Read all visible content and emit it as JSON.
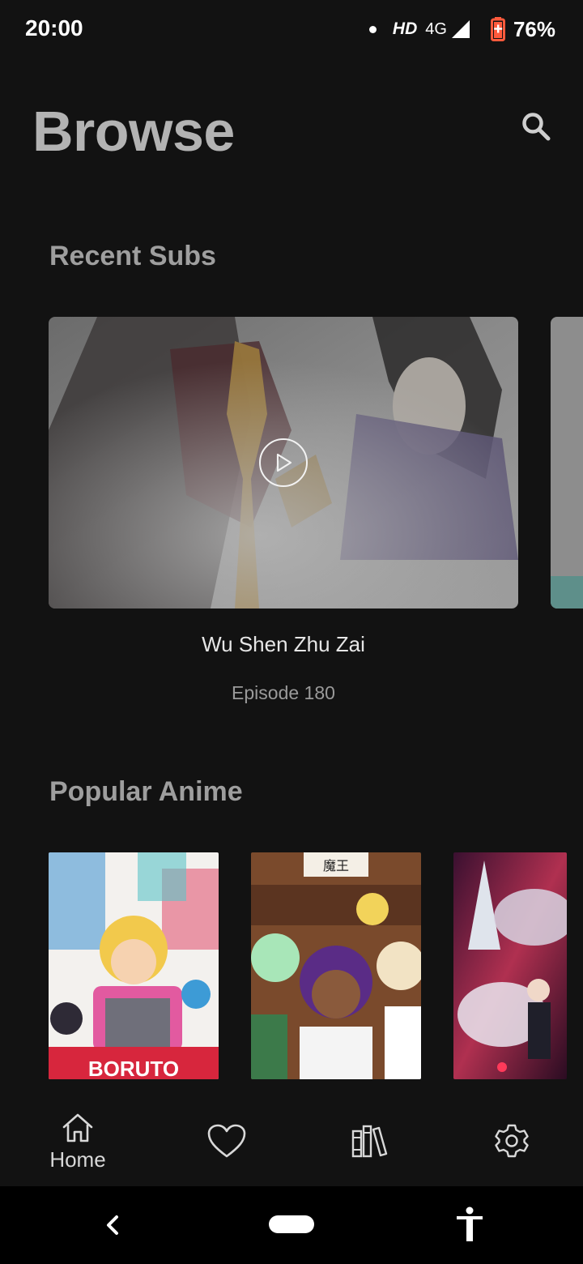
{
  "status_bar": {
    "time": "20:00",
    "hd": "HD",
    "network": "4G",
    "battery": "76%"
  },
  "header": {
    "title": "Browse",
    "search_icon": "search-icon"
  },
  "recent_subs": {
    "title": "Recent Subs",
    "items": [
      {
        "name": "Wu Shen Zhu Zai",
        "episode": "Episode 180"
      }
    ]
  },
  "popular_anime": {
    "title": "Popular Anime",
    "posters": [
      {
        "art_text": "BORUTO"
      },
      {
        "art_text": "魔王"
      },
      {
        "art_text": ""
      }
    ]
  },
  "bottom_nav": {
    "items": [
      {
        "icon": "home-icon",
        "label": "Home",
        "active": true
      },
      {
        "icon": "heart-icon",
        "label": ""
      },
      {
        "icon": "library-icon",
        "label": ""
      },
      {
        "icon": "gear-icon",
        "label": ""
      }
    ]
  },
  "colors": {
    "background": "#121212",
    "title": "#b3b3b3",
    "section_title": "#9e9e9e",
    "battery_accent": "#ff5a3c"
  }
}
